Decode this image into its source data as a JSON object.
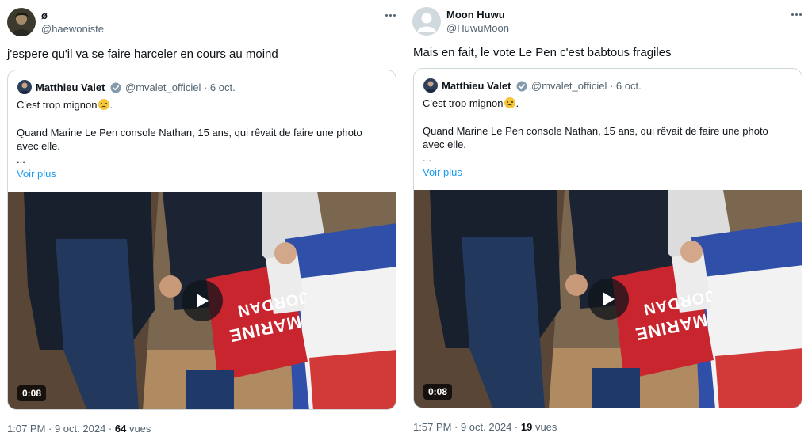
{
  "tweets": [
    {
      "display_name": "ø",
      "handle": "@haewoniste",
      "text": "j'espere qu'il va se faire harceler en cours au moind",
      "time": "1:07 PM · 9 oct. 2024 · ",
      "views_count": "64",
      "views_label": " vues",
      "avatar_icon": "profile-photo-icon"
    },
    {
      "display_name": "Moon Huwu",
      "handle": "@HuwuMoon",
      "text": "Mais en fait, le vote Le Pen c'est babtous fragiles",
      "time": "1:57 PM · 9 oct. 2024 · ",
      "views_count": "19",
      "views_label": " vues",
      "avatar_icon": "default-avatar-icon"
    }
  ],
  "quote": {
    "name": "Matthieu Valet",
    "meta": "@mvalet_officiel · 6 oct.",
    "line1": "C'est trop mignon",
    "emoji": "pleading-face-emoji",
    "line2": "Quand Marine Le Pen console Nathan, 15 ans, qui rêvait de faire une photo",
    "line3": "avec elle.",
    "line4": "...",
    "more_link": "Voir plus",
    "verified_icon": "verified-badge-icon"
  },
  "video": {
    "duration": "0:08",
    "sign_text_top": "MARINE",
    "sign_text_bottom": "JORDAN"
  },
  "colors": {
    "link": "#1d9bf0",
    "secondary_text": "#536471",
    "border": "#cfd9de",
    "verified": "#829aab"
  }
}
